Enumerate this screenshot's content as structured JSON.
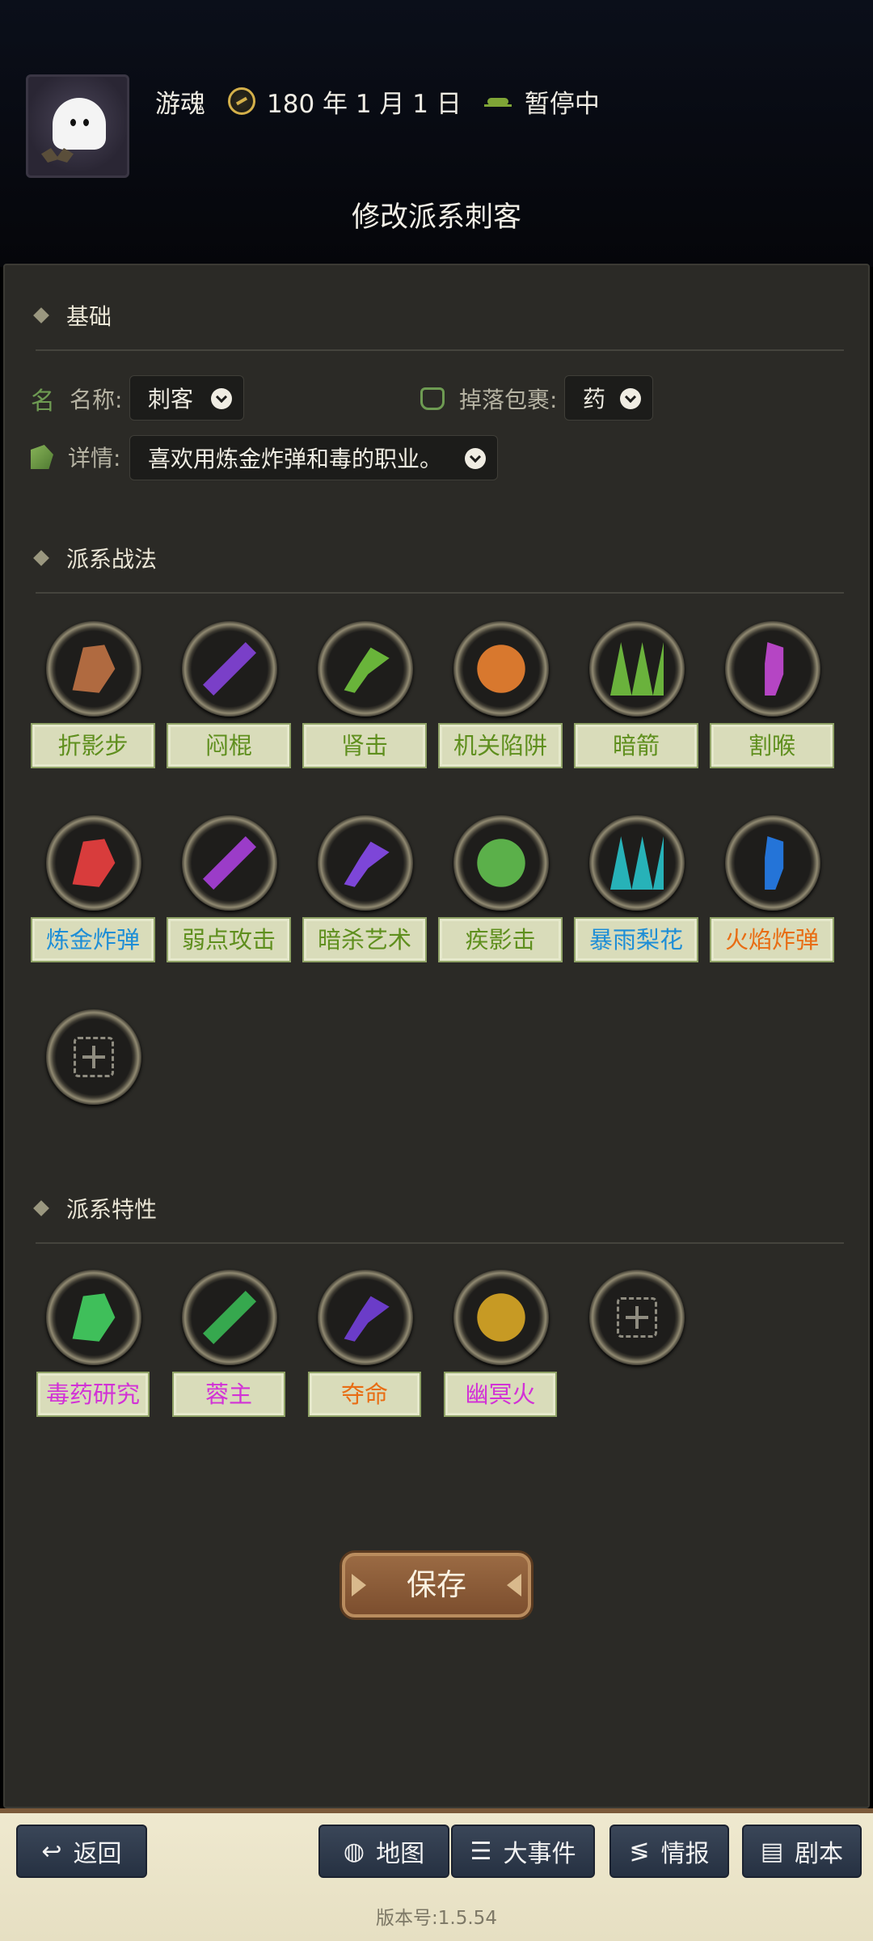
{
  "header": {
    "player_name": "游魂",
    "date": "180 年 1 月 1 日",
    "status": "暂停中",
    "page_title": "修改派系刺客"
  },
  "basic": {
    "title": "基础",
    "name_icon": "名",
    "name_label": "名称:",
    "name_value": "刺客",
    "drop_label": "掉落包裹:",
    "drop_value": "药",
    "detail_label": "详情:",
    "detail_value": "喜欢用炼金炸弹和毒的职业。"
  },
  "tactics": {
    "title": "派系战法",
    "items": [
      {
        "label": "折影步",
        "color": "green",
        "icon": "shadow-step-icon"
      },
      {
        "label": "闷棍",
        "color": "green",
        "icon": "cudgel-icon"
      },
      {
        "label": "肾击",
        "color": "green",
        "icon": "kidney-shot-icon"
      },
      {
        "label": "机关陷阱",
        "color": "green",
        "icon": "trap-icon"
      },
      {
        "label": "暗箭",
        "color": "green",
        "icon": "dark-arrow-icon"
      },
      {
        "label": "割喉",
        "color": "green",
        "icon": "throat-cut-icon"
      },
      {
        "label": "炼金炸弹",
        "color": "blue",
        "icon": "alchemy-bomb-icon"
      },
      {
        "label": "弱点攻击",
        "color": "green",
        "icon": "weak-point-icon"
      },
      {
        "label": "暗杀艺术",
        "color": "green",
        "icon": "assassination-icon"
      },
      {
        "label": "疾影击",
        "color": "green",
        "icon": "swift-shadow-icon"
      },
      {
        "label": "暴雨梨花",
        "color": "blue",
        "icon": "storm-needles-icon"
      },
      {
        "label": "火焰炸弹",
        "color": "orange",
        "icon": "fire-bomb-icon"
      }
    ]
  },
  "traits": {
    "title": "派系特性",
    "items": [
      {
        "label": "毒药研究",
        "color": "pink",
        "icon": "poison-skull-icon"
      },
      {
        "label": "蓉主",
        "color": "pink",
        "icon": "globe-icon"
      },
      {
        "label": "夺命",
        "color": "orange",
        "icon": "deadly-icon"
      },
      {
        "label": "幽冥火",
        "color": "pink",
        "icon": "footprints-icon"
      }
    ]
  },
  "save_label": "保存",
  "nav": {
    "back": "返回",
    "map": "地图",
    "events": "大事件",
    "intel": "情报",
    "script": "剧本"
  },
  "version": "版本号:1.5.54",
  "colors": {
    "panel_bg": "#2b2a26",
    "tag_bg": "#d9dcba",
    "green": "#5f8f1e",
    "blue": "#1e8ed6",
    "orange": "#e86d14",
    "pink": "#d232d6",
    "save": "#8a5a36"
  }
}
